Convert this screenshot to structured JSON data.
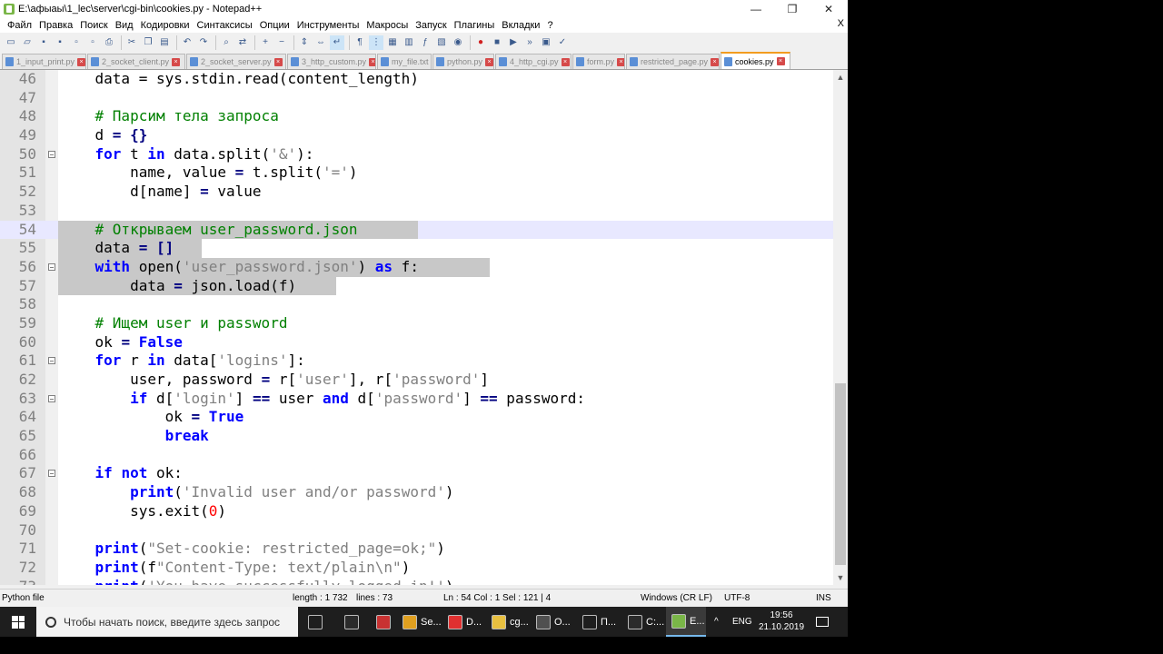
{
  "window": {
    "title": "E:\\афыаы\\1_lec\\server\\cgi-bin\\cookies.py - Notepad++",
    "minimize_glyph": "—",
    "maximize_glyph": "❐",
    "close_glyph": "✕"
  },
  "menu": {
    "items": [
      "Файл",
      "Правка",
      "Поиск",
      "Вид",
      "Кодировки",
      "Синтаксисы",
      "Опции",
      "Инструменты",
      "Макросы",
      "Запуск",
      "Плагины",
      "Вкладки",
      "?"
    ],
    "close_doc": "X"
  },
  "toolbar": {
    "icons": [
      "new-file-icon",
      "open-file-icon",
      "save-icon",
      "save-all-icon",
      "close-icon",
      "close-all-icon",
      "print-icon",
      "cut-icon",
      "copy-icon",
      "paste-icon",
      "undo-icon",
      "redo-icon",
      "find-icon",
      "replace-icon",
      "zoom-in-icon",
      "zoom-out-icon",
      "sync-vertical-icon",
      "sync-horizontal-icon",
      "word-wrap-icon",
      "show-all-chars-icon",
      "indent-guide-icon",
      "udl-icon",
      "doc-map-icon",
      "function-list-icon",
      "folder-workspace-icon",
      "monitoring-icon",
      "record-macro-icon",
      "stop-macro-icon",
      "play-macro-icon",
      "run-macro-multiple-icon",
      "save-macro-icon",
      "spellcheck-icon"
    ]
  },
  "tabs": [
    {
      "label": "1_input_print.py",
      "active": false
    },
    {
      "label": "2_socket_client.py",
      "active": false
    },
    {
      "label": "2_socket_server.py",
      "active": false
    },
    {
      "label": "3_http_custom.py",
      "active": false
    },
    {
      "label": "my_file.txt",
      "active": false
    },
    {
      "label": "python.py",
      "active": false
    },
    {
      "label": "4_http_cgi.py",
      "active": false
    },
    {
      "label": "form.py",
      "active": false
    },
    {
      "label": "restricted_page.py",
      "active": false
    },
    {
      "label": "cookies.py",
      "active": true
    }
  ],
  "editor": {
    "current_line": 54,
    "lines": [
      {
        "n": "46",
        "fold": false,
        "sel": false
      },
      {
        "n": "47",
        "fold": false,
        "sel": false
      },
      {
        "n": "48",
        "fold": false,
        "sel": false
      },
      {
        "n": "49",
        "fold": false,
        "sel": false
      },
      {
        "n": "50",
        "fold": true,
        "sel": false
      },
      {
        "n": "51",
        "fold": false,
        "sel": false
      },
      {
        "n": "52",
        "fold": false,
        "sel": false
      },
      {
        "n": "53",
        "fold": false,
        "sel": false
      },
      {
        "n": "54",
        "fold": false,
        "sel": true
      },
      {
        "n": "55",
        "fold": false,
        "sel": true
      },
      {
        "n": "56",
        "fold": true,
        "sel": true
      },
      {
        "n": "57",
        "fold": false,
        "sel": true
      },
      {
        "n": "58",
        "fold": false,
        "sel": false
      },
      {
        "n": "59",
        "fold": false,
        "sel": false
      },
      {
        "n": "60",
        "fold": false,
        "sel": false
      },
      {
        "n": "61",
        "fold": true,
        "sel": false
      },
      {
        "n": "62",
        "fold": false,
        "sel": false
      },
      {
        "n": "63",
        "fold": true,
        "sel": false
      },
      {
        "n": "64",
        "fold": false,
        "sel": false
      },
      {
        "n": "65",
        "fold": false,
        "sel": false
      },
      {
        "n": "66",
        "fold": false,
        "sel": false
      },
      {
        "n": "67",
        "fold": true,
        "sel": false
      },
      {
        "n": "68",
        "fold": false,
        "sel": false
      },
      {
        "n": "69",
        "fold": false,
        "sel": false
      },
      {
        "n": "70",
        "fold": false,
        "sel": false
      },
      {
        "n": "71",
        "fold": false,
        "sel": false
      },
      {
        "n": "72",
        "fold": false,
        "sel": false
      },
      {
        "n": "73",
        "fold": false,
        "sel": false
      }
    ],
    "code": [
      [
        [
          "t",
          "    data = sys.stdin.read(content_length)"
        ]
      ],
      [
        [
          "t",
          ""
        ]
      ],
      [
        [
          "t",
          "    "
        ],
        [
          "cm",
          "# Парсим тела запроса"
        ]
      ],
      [
        [
          "t",
          "    d "
        ],
        [
          "op",
          "="
        ],
        [
          "t",
          " "
        ],
        [
          "op",
          "{}"
        ]
      ],
      [
        [
          "t",
          "    "
        ],
        [
          "kw",
          "for"
        ],
        [
          "t",
          " t "
        ],
        [
          "kw",
          "in"
        ],
        [
          "t",
          " data.split("
        ],
        [
          "st",
          "'&'"
        ],
        [
          "t",
          "):"
        ]
      ],
      [
        [
          "t",
          "        name, value "
        ],
        [
          "op",
          "="
        ],
        [
          "t",
          " t.split("
        ],
        [
          "st",
          "'='"
        ],
        [
          "t",
          ")"
        ]
      ],
      [
        [
          "t",
          "        d[name] "
        ],
        [
          "op",
          "="
        ],
        [
          "t",
          " value"
        ]
      ],
      [
        [
          "t",
          ""
        ]
      ],
      [
        [
          "t",
          "    "
        ],
        [
          "cm",
          "# Открываем user_password.json"
        ]
      ],
      [
        [
          "t",
          "    data "
        ],
        [
          "op",
          "="
        ],
        [
          "t",
          " "
        ],
        [
          "op",
          "[]"
        ]
      ],
      [
        [
          "t",
          "    "
        ],
        [
          "kw",
          "with"
        ],
        [
          "t",
          " open("
        ],
        [
          "st",
          "'user_password.json'"
        ],
        [
          "t",
          ") "
        ],
        [
          "kw",
          "as"
        ],
        [
          "t",
          " f:"
        ]
      ],
      [
        [
          "t",
          "        data "
        ],
        [
          "op",
          "="
        ],
        [
          "t",
          " json.load(f)"
        ]
      ],
      [
        [
          "t",
          ""
        ]
      ],
      [
        [
          "t",
          "    "
        ],
        [
          "cm",
          "# Ищем user и password"
        ]
      ],
      [
        [
          "t",
          "    ok "
        ],
        [
          "op",
          "="
        ],
        [
          "t",
          " "
        ],
        [
          "kw",
          "False"
        ]
      ],
      [
        [
          "t",
          "    "
        ],
        [
          "kw",
          "for"
        ],
        [
          "t",
          " r "
        ],
        [
          "kw",
          "in"
        ],
        [
          "t",
          " data["
        ],
        [
          "st",
          "'logins'"
        ],
        [
          "t",
          "]:"
        ]
      ],
      [
        [
          "t",
          "        user, password "
        ],
        [
          "op",
          "="
        ],
        [
          "t",
          " r["
        ],
        [
          "st",
          "'user'"
        ],
        [
          "t",
          "], r["
        ],
        [
          "st",
          "'password'"
        ],
        [
          "t",
          "]"
        ]
      ],
      [
        [
          "t",
          "        "
        ],
        [
          "kw",
          "if"
        ],
        [
          "t",
          " d["
        ],
        [
          "st",
          "'login'"
        ],
        [
          "t",
          "] "
        ],
        [
          "op",
          "=="
        ],
        [
          "t",
          " user "
        ],
        [
          "kw",
          "and"
        ],
        [
          "t",
          " d["
        ],
        [
          "st",
          "'password'"
        ],
        [
          "t",
          "] "
        ],
        [
          "op",
          "=="
        ],
        [
          "t",
          " password:"
        ]
      ],
      [
        [
          "t",
          "            ok "
        ],
        [
          "op",
          "="
        ],
        [
          "t",
          " "
        ],
        [
          "kw",
          "True"
        ]
      ],
      [
        [
          "t",
          "            "
        ],
        [
          "kw",
          "break"
        ]
      ],
      [
        [
          "t",
          ""
        ]
      ],
      [
        [
          "t",
          "    "
        ],
        [
          "kw",
          "if"
        ],
        [
          "t",
          " "
        ],
        [
          "kw",
          "not"
        ],
        [
          "t",
          " ok:"
        ]
      ],
      [
        [
          "t",
          "        "
        ],
        [
          "kw",
          "print"
        ],
        [
          "t",
          "("
        ],
        [
          "st",
          "'Invalid user and/or password'"
        ],
        [
          "t",
          ")"
        ]
      ],
      [
        [
          "t",
          "        sys.exit("
        ],
        [
          "nu",
          "0"
        ],
        [
          "t",
          ")"
        ]
      ],
      [
        [
          "t",
          ""
        ]
      ],
      [
        [
          "t",
          "    "
        ],
        [
          "kw",
          "print"
        ],
        [
          "t",
          "("
        ],
        [
          "st",
          "\"Set-cookie: restricted_page=ok;\""
        ],
        [
          "t",
          ")"
        ]
      ],
      [
        [
          "t",
          "    "
        ],
        [
          "kw",
          "print"
        ],
        [
          "t",
          "(f"
        ],
        [
          "st",
          "\"Content-Type: text/plain\\n\""
        ],
        [
          "t",
          ")"
        ]
      ],
      [
        [
          "t",
          "    "
        ],
        [
          "kw",
          "print"
        ],
        [
          "t",
          "("
        ],
        [
          "st",
          "'You have successfully logged in!'"
        ],
        [
          "t",
          ")"
        ]
      ]
    ]
  },
  "status": {
    "language": "Python file",
    "length": "length : 1 732",
    "lines": "lines : 73",
    "position": "Ln : 54    Col : 1    Sel : 121 | 4",
    "eol": "Windows (CR LF)",
    "encoding": "UTF-8",
    "mode": "INS"
  },
  "taskbar": {
    "search_placeholder": "Чтобы начать поиск, введите здесь запрос",
    "apps": [
      {
        "label": "",
        "icon": "task-view-icon",
        "color": "#1e1e1e"
      },
      {
        "label": "",
        "icon": "terminal-icon",
        "color": "#2b2b2b"
      },
      {
        "label": "",
        "icon": "paint-icon",
        "color": "#c83232"
      },
      {
        "label": "Se...",
        "icon": "chrome-icon",
        "color": "#e0a020"
      },
      {
        "label": "D...",
        "icon": "yandex-icon",
        "color": "#e03030"
      },
      {
        "label": "cg...",
        "icon": "folder-icon",
        "color": "#e8c040"
      },
      {
        "label": "O...",
        "icon": "obs-icon",
        "color": "#505050"
      },
      {
        "label": "П...",
        "icon": "settings-icon",
        "color": "#1e1e1e"
      },
      {
        "label": "C:...",
        "icon": "cmd-icon",
        "color": "#2b2b2b"
      },
      {
        "label": "E...",
        "icon": "notepadpp-icon",
        "color": "#7ab648"
      }
    ],
    "tray_chevron": "^",
    "language": "ENG",
    "time": "19:56",
    "date": "21.10.2019"
  }
}
